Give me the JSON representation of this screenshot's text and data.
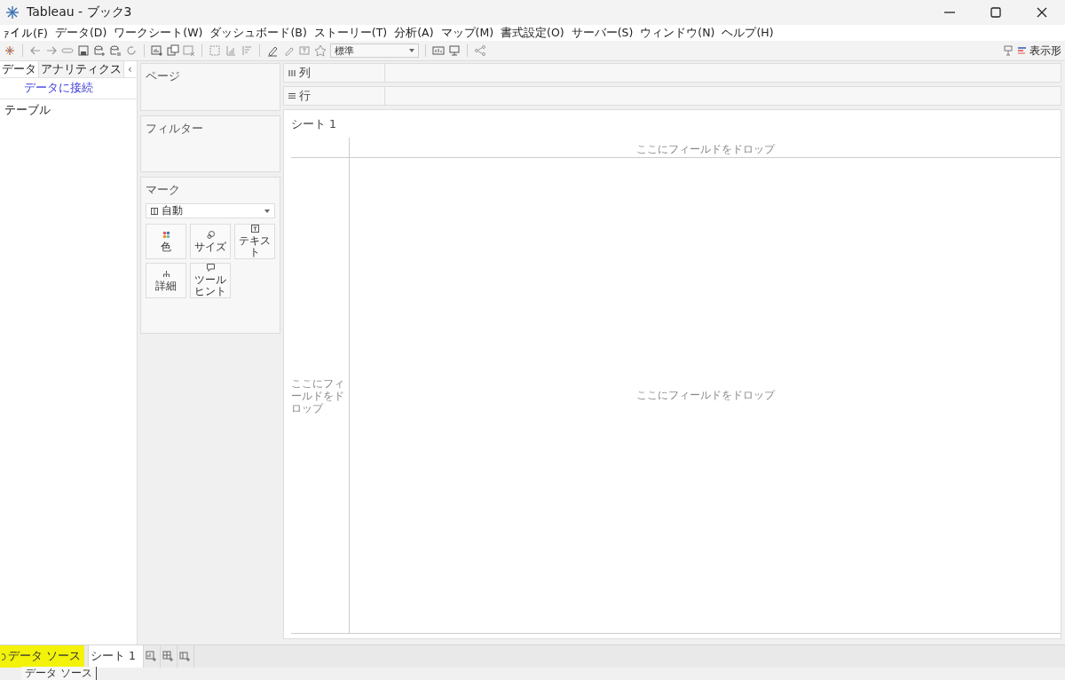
{
  "window": {
    "title": "Tableau - ブック3"
  },
  "menu": [
    "ｧイル(F)",
    "データ(D)",
    "ワークシート(W)",
    "ダッシュボード(B)",
    "ストーリー(T)",
    "分析(A)",
    "マップ(M)",
    "書式設定(O)",
    "サーバー(S)",
    "ウィンドウ(N)",
    "ヘルプ(H)"
  ],
  "toolbar": {
    "fit_select": "標準",
    "show_me": "表示形"
  },
  "left_pane": {
    "tabs": [
      {
        "label": "データ",
        "selected": true
      },
      {
        "label": "アナリティクス",
        "selected": false
      }
    ],
    "collapse": "‹",
    "connect_link": "データに接続",
    "section": "テーブル"
  },
  "cards": {
    "pages": "ページ",
    "filters": "フィルター",
    "marks": {
      "title": "マーク",
      "mark_type": "自動",
      "buttons": [
        {
          "label": "色",
          "kind": "color"
        },
        {
          "label": "サイズ",
          "kind": "size"
        },
        {
          "label": "テキスト",
          "kind": "text"
        },
        {
          "label": "詳細",
          "kind": "detail"
        },
        {
          "label": "ツールヒント",
          "kind": "tooltip"
        }
      ]
    }
  },
  "shelves": [
    {
      "label": "列",
      "kind": "columns"
    },
    {
      "label": "行",
      "kind": "rows"
    }
  ],
  "sheet": {
    "title": "シート 1",
    "drop_top": "ここにフィールドをドロップ",
    "drop_left": "ここにフィールドをドロップ",
    "drop_center": "ここにフィールドをドロップ"
  },
  "tabs": [
    {
      "label": "データ ソース",
      "selected": false,
      "highlighted": true
    },
    {
      "label": "シート 1",
      "selected": true,
      "highlighted": false
    }
  ],
  "tooltip": "データ ソース"
}
